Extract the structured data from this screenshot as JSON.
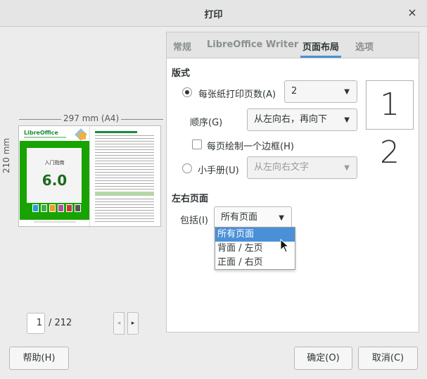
{
  "window": {
    "title": "打印",
    "close_glyph": "×"
  },
  "preview": {
    "paper_label": "297 mm (A4)",
    "height_label": "210 mm",
    "left_page": {
      "brand": "LibreOffice",
      "guide_title": "入门指南",
      "version": "6.0"
    }
  },
  "pager": {
    "current_page": "1",
    "total": "/ 212",
    "prev_glyph": "◂",
    "next_glyph": "▸"
  },
  "tabs": [
    {
      "label": "常规"
    },
    {
      "label": "LibreOffice Writer"
    },
    {
      "label": "页面布局"
    },
    {
      "label": "选项"
    }
  ],
  "active_tab": "页面布局",
  "layout": {
    "section_title": "版式",
    "pages_per_sheet_label": "每张纸打印页数(A)",
    "pages_per_sheet_value": "2",
    "order_label": "顺序(G)",
    "order_value": "从左向右，再向下",
    "draw_border_label": "每页绘制一个边框(H)",
    "booklet_label": "小手册(U)",
    "booklet_value": "从左向右文字",
    "pages_preview": "1 2"
  },
  "sides": {
    "section_title": "左右页面",
    "include_label": "包括(I)",
    "include_value": "所有页面",
    "options": [
      "所有页面",
      "背面 / 左页",
      "正面 / 右页"
    ]
  },
  "buttons": {
    "help": "帮助(H)",
    "ok": "确定(O)",
    "cancel": "取消(C)"
  },
  "icons": {
    "dropdown": "chevron-down-icon",
    "cursor": "mouse-pointer-icon"
  }
}
